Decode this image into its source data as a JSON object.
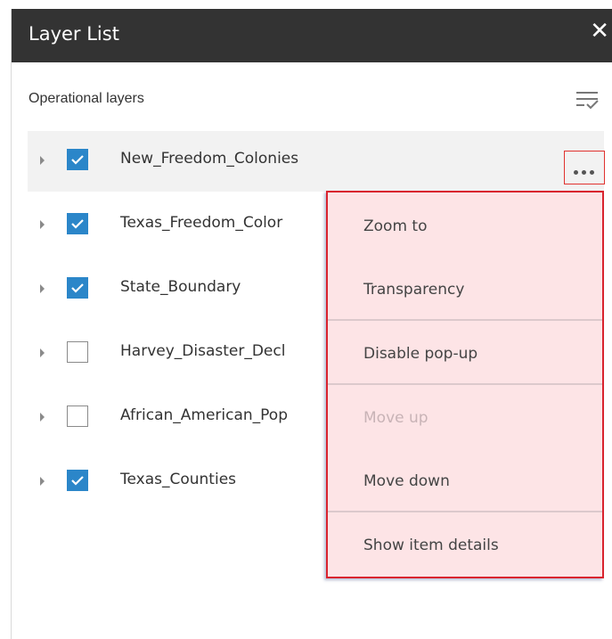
{
  "window": {
    "title": "Layer List",
    "close_glyph": "✕"
  },
  "section": {
    "label": "Operational layers",
    "filter_icon": "filter-list-icon"
  },
  "layers": [
    {
      "name": "New_Freedom_Colonies",
      "checked": true
    },
    {
      "name": "Texas_Freedom_Colonies",
      "checked": true,
      "visible_text": "Texas_Freedom_Color"
    },
    {
      "name": "State_Boundary",
      "checked": true
    },
    {
      "name": "Harvey_Disaster_Declarations",
      "checked": false,
      "visible_text": "Harvey_Disaster_Decl"
    },
    {
      "name": "African_American_Population",
      "checked": false,
      "visible_text": "African_American_Pop"
    },
    {
      "name": "Texas_Counties",
      "checked": true
    }
  ],
  "more_options": {
    "icon": "ellipsis-icon"
  },
  "context_menu": {
    "items": [
      {
        "label": "Zoom to",
        "enabled": true
      },
      {
        "label": "Transparency",
        "enabled": true
      },
      {
        "label": "Disable pop-up",
        "enabled": true
      },
      {
        "label": "Move up",
        "enabled": false
      },
      {
        "label": "Move down",
        "enabled": true
      },
      {
        "label": "Show item details",
        "enabled": true
      }
    ]
  },
  "colors": {
    "titlebar": "#333333",
    "checkbox_checked": "#2b86c9",
    "menu_background": "#fde4e6",
    "highlight_border": "#d9232e"
  }
}
